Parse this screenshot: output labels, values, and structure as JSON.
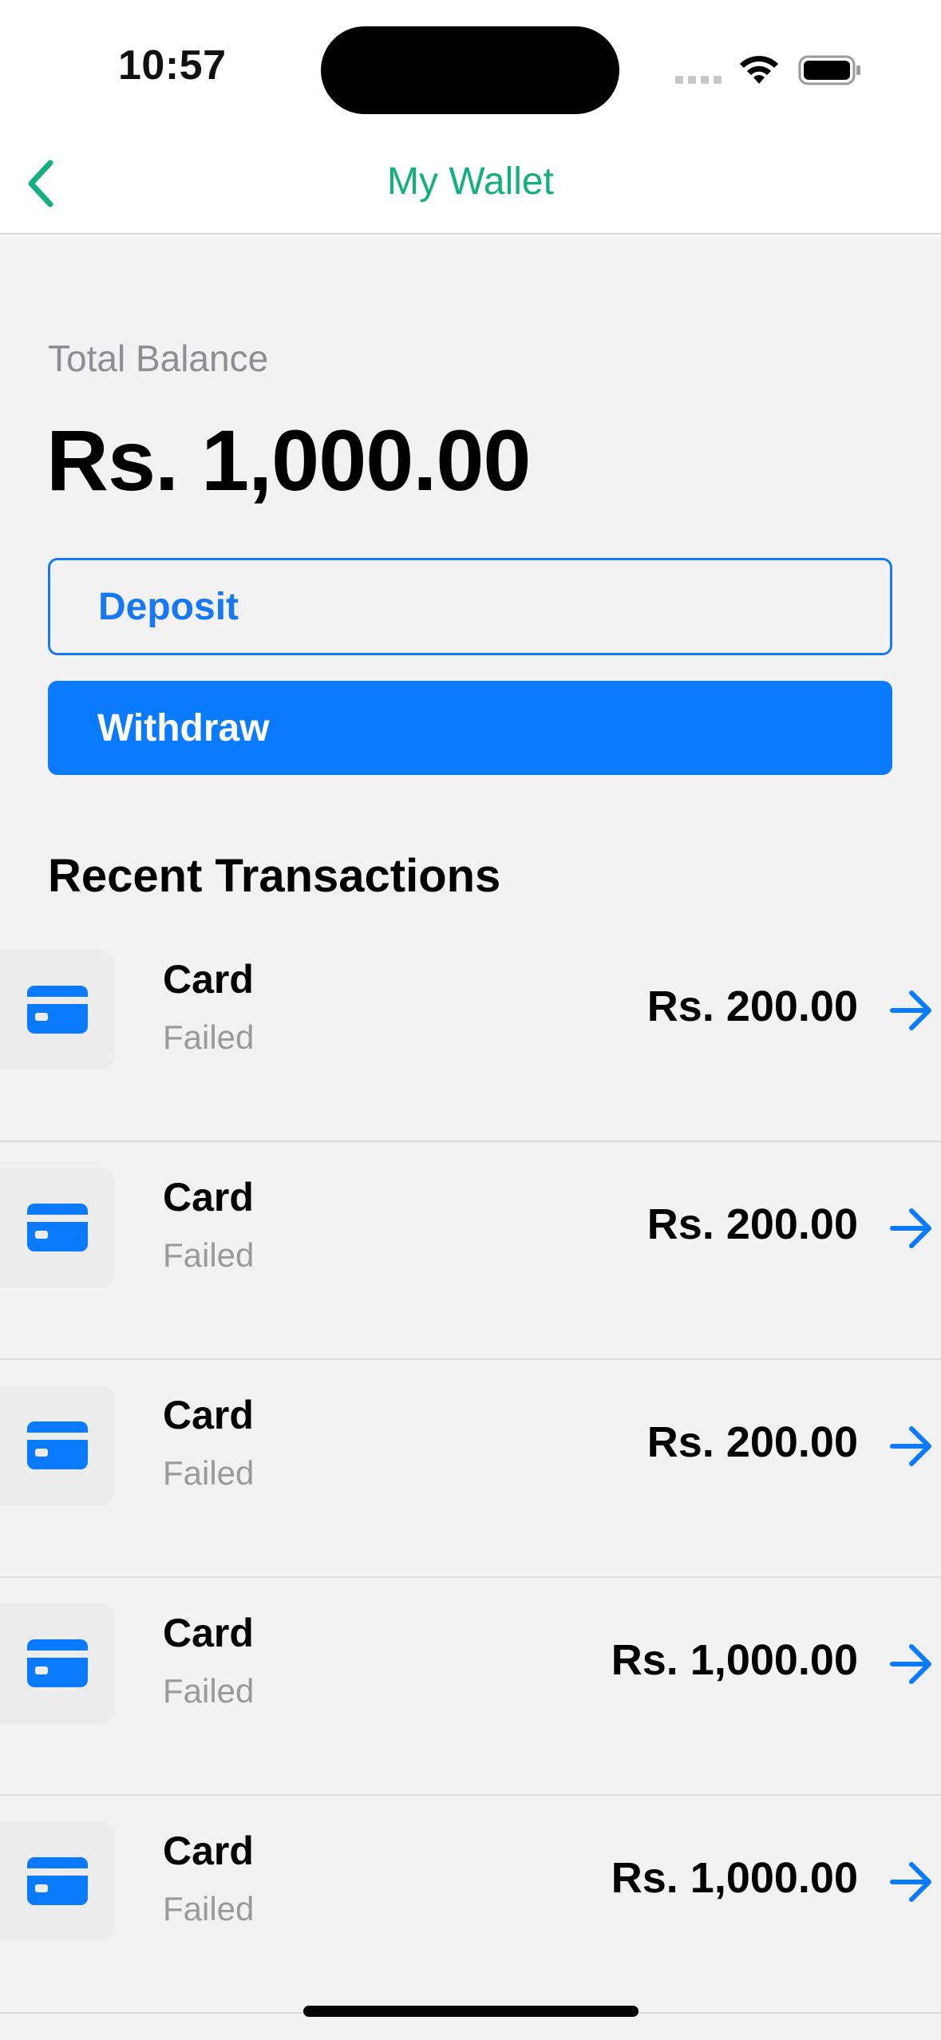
{
  "status_bar": {
    "time": "10:57"
  },
  "nav": {
    "title": "My Wallet",
    "back_icon": "chevron-left-icon"
  },
  "wallet": {
    "balance_label": "Total Balance",
    "balance_amount": "Rs. 1,000.00",
    "deposit_label": "Deposit",
    "withdraw_label": "Withdraw"
  },
  "transactions": {
    "section_title": "Recent Transactions",
    "items": [
      {
        "title": "Card",
        "status": "Failed",
        "amount": "Rs. 200.00"
      },
      {
        "title": "Card",
        "status": "Failed",
        "amount": "Rs. 200.00"
      },
      {
        "title": "Card",
        "status": "Failed",
        "amount": "Rs. 200.00"
      },
      {
        "title": "Card",
        "status": "Failed",
        "amount": "Rs. 1,000.00"
      },
      {
        "title": "Card",
        "status": "Failed",
        "amount": "Rs. 1,000.00"
      }
    ]
  },
  "colors": {
    "accent": "#0a7aff",
    "title_green": "#13b07a",
    "muted": "#8e8e93",
    "background": "#f2f2f2"
  }
}
